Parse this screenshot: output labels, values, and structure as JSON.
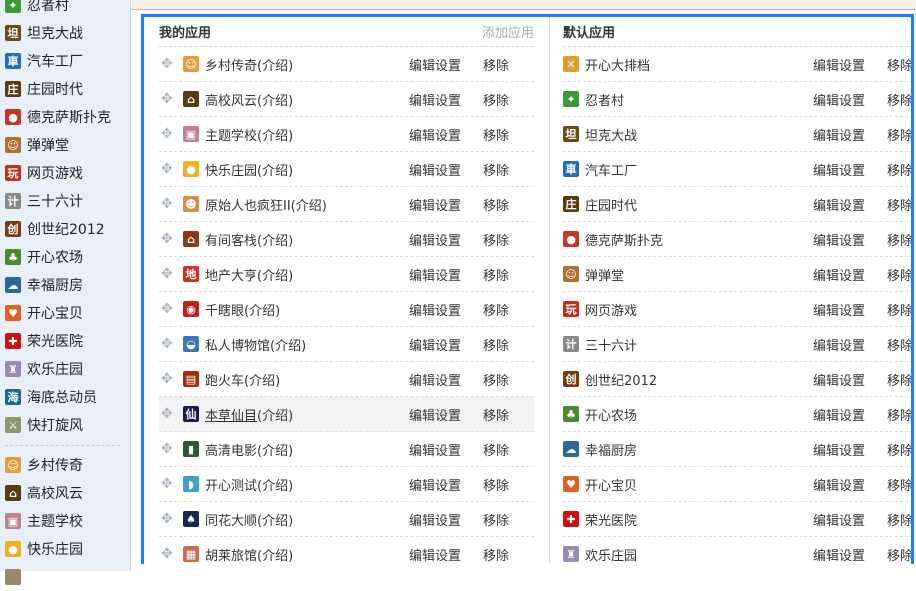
{
  "sidebar": {
    "items": [
      {
        "label": "忍者村",
        "icon": "ninja-icon",
        "color": "#3a9a3a",
        "glyph": "✦"
      },
      {
        "label": "坦克大战",
        "icon": "tank-icon",
        "color": "#6b4a1a",
        "glyph": "坦"
      },
      {
        "label": "汽车工厂",
        "icon": "car-factory-icon",
        "color": "#1f6fc0",
        "glyph": "車"
      },
      {
        "label": "庄园时代",
        "icon": "manor-icon",
        "color": "#5a3a10",
        "glyph": "庄"
      },
      {
        "label": "德克萨斯扑克",
        "icon": "poker-chip-icon",
        "color": "#c0392b",
        "glyph": "●"
      },
      {
        "label": "弹弹堂",
        "icon": "ddt-icon",
        "color": "#b07030",
        "glyph": "☺"
      },
      {
        "label": "网页游戏",
        "icon": "web-game-icon",
        "color": "#c0301a",
        "glyph": "玩"
      },
      {
        "label": "三十六计",
        "icon": "strategy-icon",
        "color": "#888",
        "glyph": "计"
      },
      {
        "label": "创世纪2012",
        "icon": "genesis-icon",
        "color": "#7a3a10",
        "glyph": "创"
      },
      {
        "label": "开心农场",
        "icon": "farm-icon",
        "color": "#4a8a2a",
        "glyph": "♣"
      },
      {
        "label": "幸福厨房",
        "icon": "kitchen-icon",
        "color": "#2a6a9a",
        "glyph": "☁"
      },
      {
        "label": "开心宝贝",
        "icon": "baby-icon",
        "color": "#e06020",
        "glyph": "♥"
      },
      {
        "label": "荣光医院",
        "icon": "hospital-icon",
        "color": "#d01010",
        "glyph": "✚"
      },
      {
        "label": "欢乐庄园",
        "icon": "castle-icon",
        "color": "#9a8ab0",
        "glyph": "♜"
      },
      {
        "label": "海底总动员",
        "icon": "sea-icon",
        "color": "#1a6a8a",
        "glyph": "海"
      },
      {
        "label": "快打旋风",
        "icon": "swords-icon",
        "color": "#8a9a6a",
        "glyph": "⚔"
      }
    ],
    "items2": [
      {
        "label": "乡村传奇",
        "icon": "village-icon",
        "color": "#e0a040",
        "glyph": "☺"
      },
      {
        "label": "高校风云",
        "icon": "house-icon",
        "color": "#5a3a10",
        "glyph": "⌂"
      },
      {
        "label": "主题学校",
        "icon": "school-icon",
        "color": "#c08090",
        "glyph": "▣"
      },
      {
        "label": "快乐庄园",
        "icon": "chick-icon",
        "color": "#f0b020",
        "glyph": "●"
      },
      {
        "label": "",
        "icon": "app-icon",
        "color": "#998866",
        "glyph": ""
      }
    ]
  },
  "my_apps": {
    "title": "我的应用",
    "add_label": "添加应用",
    "edit_label": "编辑设置",
    "remove_label": "移除",
    "items": [
      {
        "name": "乡村传奇",
        "intro": "(介绍)",
        "icon": "village-icon",
        "color": "#e0a040",
        "glyph": "☺"
      },
      {
        "name": "高校风云",
        "intro": "(介绍)",
        "icon": "house-icon",
        "color": "#5a3a10",
        "glyph": "⌂"
      },
      {
        "name": "主题学校",
        "intro": "(介绍)",
        "icon": "school-icon",
        "color": "#c08090",
        "glyph": "▣"
      },
      {
        "name": "快乐庄园",
        "intro": "(介绍)",
        "icon": "chick-icon",
        "color": "#f0b020",
        "glyph": "●"
      },
      {
        "name": "原始人也疯狂II",
        "intro": "(介绍)",
        "icon": "caveman-icon",
        "color": "#d09050",
        "glyph": "☻"
      },
      {
        "name": "有间客栈",
        "intro": "(介绍)",
        "icon": "inn-icon",
        "color": "#8a3a1a",
        "glyph": "⌂"
      },
      {
        "name": "地产大亨",
        "intro": "(介绍)",
        "icon": "realestate-icon",
        "color": "#d03020",
        "glyph": "地"
      },
      {
        "name": "千瞎眼",
        "intro": "(介绍)",
        "icon": "eye-icon",
        "color": "#c02020",
        "glyph": "◉"
      },
      {
        "name": "私人博物馆",
        "intro": "(介绍)",
        "icon": "museum-icon",
        "color": "#3a7ab0",
        "glyph": "◒"
      },
      {
        "name": "跑火车",
        "intro": "(介绍)",
        "icon": "train-icon",
        "color": "#a03010",
        "glyph": "▤"
      },
      {
        "name": "本草仙目",
        "intro": "(介绍)",
        "icon": "herb-icon",
        "color": "#1a1a5a",
        "glyph": "仙",
        "highlight": true
      },
      {
        "name": "高清电影",
        "intro": "(介绍)",
        "icon": "film-icon",
        "color": "#2a5a3a",
        "glyph": "▮"
      },
      {
        "name": "开心测试",
        "intro": "(介绍)",
        "icon": "dolphin-icon",
        "color": "#40a0d0",
        "glyph": "◗"
      },
      {
        "name": "同花大顺",
        "intro": "(介绍)",
        "icon": "spade-icon",
        "color": "#102a5a",
        "glyph": "♠"
      },
      {
        "name": "胡莱旅馆",
        "intro": "(介绍)",
        "icon": "hotel-icon",
        "color": "#c07050",
        "glyph": "▦"
      }
    ]
  },
  "default_apps": {
    "title": "默认应用",
    "edit_label": "编辑设置",
    "remove_label": "移除",
    "items": [
      {
        "name": "开心大排档",
        "icon": "food-stall-icon",
        "color": "#e0a030",
        "glyph": "✕"
      },
      {
        "name": "忍者村",
        "icon": "ninja-icon",
        "color": "#3a9a3a",
        "glyph": "✦"
      },
      {
        "name": "坦克大战",
        "icon": "tank-icon",
        "color": "#6b4a1a",
        "glyph": "坦"
      },
      {
        "name": "汽车工厂",
        "icon": "car-factory-icon",
        "color": "#1f6fc0",
        "glyph": "車"
      },
      {
        "name": "庄园时代",
        "icon": "manor-icon",
        "color": "#5a3a10",
        "glyph": "庄"
      },
      {
        "name": "德克萨斯扑克",
        "icon": "poker-chip-icon",
        "color": "#c0392b",
        "glyph": "●"
      },
      {
        "name": "弹弹堂",
        "icon": "ddt-icon",
        "color": "#b07030",
        "glyph": "☺"
      },
      {
        "name": "网页游戏",
        "icon": "web-game-icon",
        "color": "#c0301a",
        "glyph": "玩"
      },
      {
        "name": "三十六计",
        "icon": "strategy-icon",
        "color": "#888",
        "glyph": "计"
      },
      {
        "name": "创世纪2012",
        "icon": "genesis-icon",
        "color": "#7a3a10",
        "glyph": "创"
      },
      {
        "name": "开心农场",
        "icon": "farm-icon",
        "color": "#4a8a2a",
        "glyph": "♣"
      },
      {
        "name": "幸福厨房",
        "icon": "kitchen-icon",
        "color": "#2a6a9a",
        "glyph": "☁"
      },
      {
        "name": "开心宝贝",
        "icon": "baby-icon",
        "color": "#e06020",
        "glyph": "♥"
      },
      {
        "name": "荣光医院",
        "icon": "hospital-icon",
        "color": "#d01010",
        "glyph": "✚"
      },
      {
        "name": "欢乐庄园",
        "icon": "castle-icon",
        "color": "#9a8ab0",
        "glyph": "♜"
      }
    ]
  }
}
